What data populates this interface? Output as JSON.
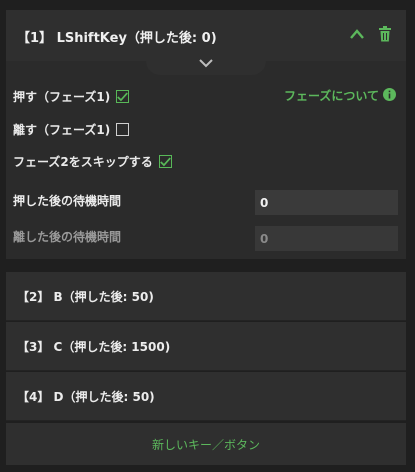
{
  "expanded_key": {
    "title": "【1】 LShiftKey（押した後: 0)",
    "press_phase1_label": "押す（フェーズ1)",
    "press_phase1_checked": true,
    "release_phase1_label": "離す（フェーズ1)",
    "release_phase1_checked": false,
    "skip_phase2_label": "フェーズ2をスキップする",
    "skip_phase2_checked": true,
    "phase_info_label": "フェーズについて",
    "wait_after_press_label": "押した後の待機時間",
    "wait_after_press_value": "0",
    "wait_after_release_label": "離した後の待機時間",
    "wait_after_release_value": "0"
  },
  "keys": [
    {
      "label": "【2】 B（押した後: 50)"
    },
    {
      "label": "【3】 C（押した後: 1500)"
    },
    {
      "label": "【4】 D（押した後: 50)"
    }
  ],
  "new_key_label": "新しいキー／ボタン",
  "icons": {
    "collapse": "chevron-up-icon",
    "delete": "trash-icon",
    "expand_tab": "chevron-down-icon",
    "info": "info-icon",
    "check": "check-icon"
  },
  "colors": {
    "accent": "#5cb85c",
    "background": "#1f1f1f",
    "panel": "#2f2f2f"
  }
}
